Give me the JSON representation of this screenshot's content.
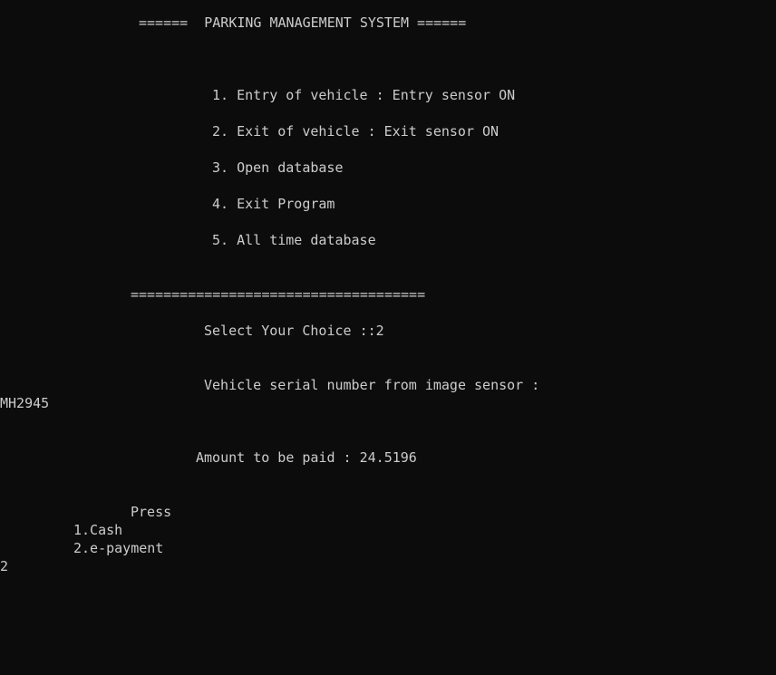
{
  "console": {
    "banner": "======  PARKING MANAGEMENT SYSTEM ======",
    "menu": [
      "1. Entry of vehicle : Entry sensor ON",
      "2. Exit of vehicle : Exit sensor ON",
      "3. Open database",
      "4. Exit Program",
      "5. All time database"
    ],
    "separator": "====================================",
    "choice_prompt": "Select Your Choice ::2",
    "serial_prompt": "Vehicle serial number from image sensor :",
    "serial_value": "MH2945",
    "amount_text": "Amount to be paid : 24.5196",
    "press_label": "Press",
    "payment_options": [
      "1.Cash",
      "2.e-payment"
    ],
    "user_input": "2"
  },
  "colors": {
    "background": "#0c0c0c",
    "text": "#cccccc"
  }
}
